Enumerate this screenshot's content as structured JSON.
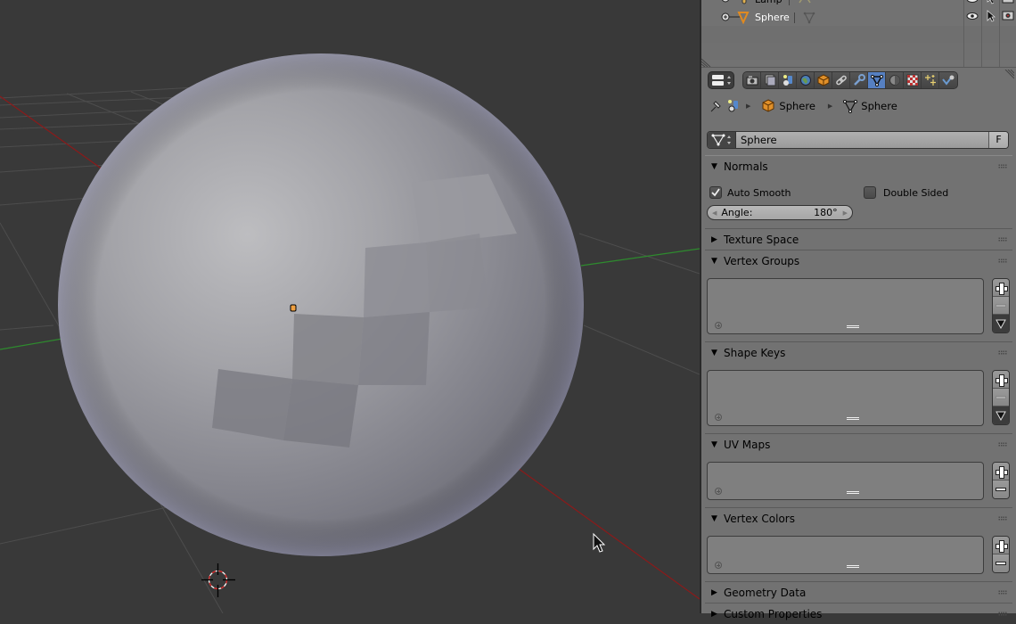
{
  "outliner": {
    "rows": [
      {
        "name": "Lamp",
        "type": "lamp"
      },
      {
        "name": "Sphere",
        "type": "mesh"
      }
    ]
  },
  "properties": {
    "context_tabs": [
      {
        "name": "render",
        "icon": "camera-icon",
        "active": false
      },
      {
        "name": "render-layers",
        "icon": "render-layers-icon",
        "active": false
      },
      {
        "name": "scene",
        "icon": "scene-icon",
        "active": false
      },
      {
        "name": "world",
        "icon": "world-icon",
        "active": false
      },
      {
        "name": "object",
        "icon": "object-cube-icon",
        "active": false
      },
      {
        "name": "constraints",
        "icon": "constraint-link-icon",
        "active": false
      },
      {
        "name": "modifiers",
        "icon": "wrench-icon",
        "active": false
      },
      {
        "name": "data",
        "icon": "mesh-data-icon",
        "active": true
      },
      {
        "name": "material",
        "icon": "material-sphere-icon",
        "active": false
      },
      {
        "name": "texture",
        "icon": "texture-checker-icon",
        "active": false
      },
      {
        "name": "particles",
        "icon": "particles-icon",
        "active": false
      },
      {
        "name": "physics",
        "icon": "physics-icon",
        "active": false
      }
    ],
    "breadcrumb": {
      "object": "Sphere",
      "mesh": "Sphere"
    },
    "datablock": {
      "name": "Sphere",
      "fake_user": "F"
    },
    "panels": {
      "normals": {
        "title": "Normals",
        "expanded": true,
        "auto_smooth_label": "Auto Smooth",
        "auto_smooth": true,
        "double_sided_label": "Double Sided",
        "double_sided": false,
        "angle_label": "Angle:",
        "angle_value": "180°"
      },
      "texture_space": {
        "title": "Texture Space",
        "expanded": false
      },
      "vertex_groups": {
        "title": "Vertex Groups",
        "expanded": true
      },
      "shape_keys": {
        "title": "Shape Keys",
        "expanded": true
      },
      "uv_maps": {
        "title": "UV Maps",
        "expanded": true
      },
      "vertex_colors": {
        "title": "Vertex Colors",
        "expanded": true
      },
      "geometry_data": {
        "title": "Geometry Data",
        "expanded": false
      },
      "custom_properties": {
        "title": "Custom Properties",
        "expanded": false
      }
    }
  },
  "colors": {
    "viewport_bg": "#393939",
    "x_axis": "#8b1a1a",
    "y_axis": "#2e8b2e",
    "active_tab": "#5680c2",
    "object_origin": "#f0a040"
  }
}
